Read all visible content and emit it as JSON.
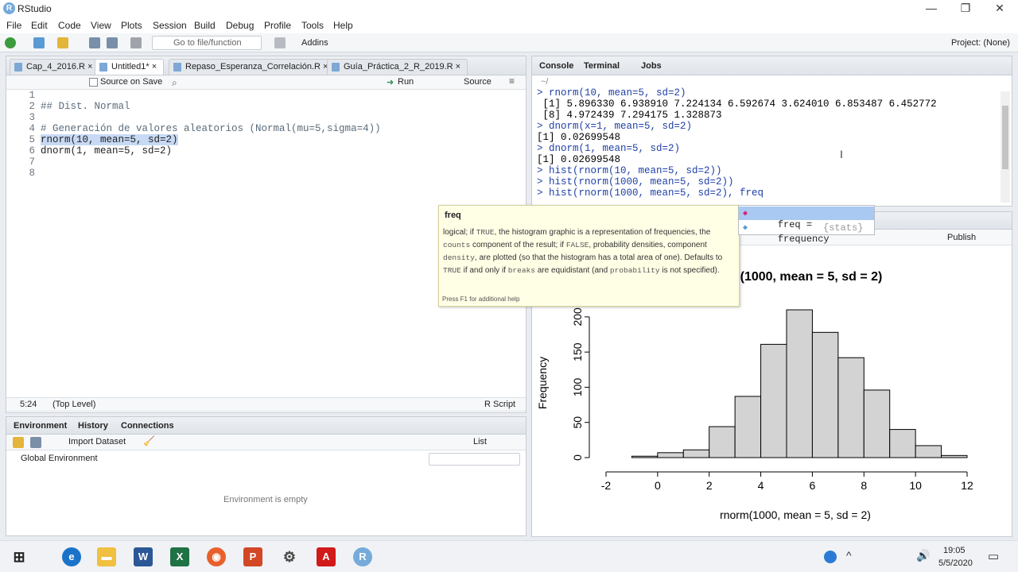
{
  "window": {
    "title": "RStudio",
    "minimize": "—",
    "restore": "❐",
    "close": "✕"
  },
  "menu": [
    "File",
    "Edit",
    "Code",
    "View",
    "Plots",
    "Session",
    "Build",
    "Debug",
    "Profile",
    "Tools",
    "Help"
  ],
  "toolbar": {
    "goto_placeholder": "Go to file/function",
    "addins_label": "Addins",
    "project_label": "Project: (None)"
  },
  "editor": {
    "tabs": [
      "Cap_4_2016.R",
      "Untitled1*",
      "Repaso_Esperanza_Correlación.R",
      "Guía_Práctica_2_R_2019.R"
    ],
    "source_on_save": "Source on Save",
    "run_label": "Run",
    "source_label": "Source",
    "lines": [
      {
        "n": "1",
        "text": ""
      },
      {
        "n": "2",
        "text": "## Dist. Normal"
      },
      {
        "n": "3",
        "text": ""
      },
      {
        "n": "4",
        "text": "# Generación de valores aleatorios (Normal(mu=5,sigma=4))"
      },
      {
        "n": "5",
        "text": "rnorm(10, mean=5, sd=2)"
      },
      {
        "n": "6",
        "text": "dnorm(1, mean=5, sd=2)"
      },
      {
        "n": "7",
        "text": ""
      },
      {
        "n": "8",
        "text": ""
      }
    ],
    "status_pos": "5:24",
    "status_scope": "(Top Level)",
    "status_type": "R Script"
  },
  "env": {
    "tabs": [
      "Environment",
      "History",
      "Connections"
    ],
    "import_label": "Import Dataset",
    "list_label": "List",
    "global_env": "Global Environment",
    "empty_text": "Environment is empty"
  },
  "console": {
    "tabs": [
      "Console",
      "Terminal",
      "Jobs"
    ],
    "path": "~/",
    "lines": [
      {
        "kind": "cmd",
        "text": "> rnorm(10, mean=5, sd=2)"
      },
      {
        "kind": "out",
        "text": " [1] 5.896330 6.938910 7.224134 6.592674 3.624010 6.853487 6.452772"
      },
      {
        "kind": "out",
        "text": " [8] 4.972439 7.294175 1.328873"
      },
      {
        "kind": "cmd",
        "text": "> dnorm(x=1, mean=5, sd=2)"
      },
      {
        "kind": "out",
        "text": "[1] 0.02699548"
      },
      {
        "kind": "cmd",
        "text": "> dnorm(1, mean=5, sd=2)"
      },
      {
        "kind": "out",
        "text": "[1] 0.02699548"
      },
      {
        "kind": "cmd",
        "text": "> hist(rnorm(10, mean=5, sd=2))"
      },
      {
        "kind": "cmd",
        "text": "> hist(rnorm(1000, mean=5, sd=2))"
      },
      {
        "kind": "cmd",
        "text": "> hist(rnorm(1000, mean=5, sd=2), freq"
      }
    ]
  },
  "autocomplete": {
    "items": [
      {
        "label": "freq =",
        "pkg": ""
      },
      {
        "label": "frequency",
        "pkg": "{stats}"
      }
    ]
  },
  "tooltip": {
    "title": "freq",
    "body_parts": [
      {
        "t": "logical; if ",
        "code": false
      },
      {
        "t": "TRUE",
        "code": true
      },
      {
        "t": ", the histogram graphic is a representation of frequencies, the ",
        "code": false
      },
      {
        "t": "counts",
        "code": true
      },
      {
        "t": " component of the result; if ",
        "code": false
      },
      {
        "t": "FALSE",
        "code": true
      },
      {
        "t": ", probability densities, component ",
        "code": false
      },
      {
        "t": "density",
        "code": true
      },
      {
        "t": ", are plotted (so that the histogram has a total area of one). Defaults to ",
        "code": false
      },
      {
        "t": "TRUE",
        "code": true
      },
      {
        "t": " if and only if ",
        "code": false
      },
      {
        "t": "breaks",
        "code": true
      },
      {
        "t": " are equidistant (and ",
        "code": false
      },
      {
        "t": "probability",
        "code": true
      },
      {
        "t": " is not specified).",
        "code": false
      }
    ],
    "footer": "Press F1 for additional help"
  },
  "plots": {
    "publish_label": "Publish"
  },
  "chart_data": {
    "type": "bar",
    "title": "norm(1000, mean = 5, sd = 2)",
    "xlabel": "rnorm(1000, mean = 5, sd = 2)",
    "ylabel": "Frequency",
    "bin_edges": [
      -1,
      0,
      1,
      2,
      3,
      4,
      5,
      6,
      7,
      8,
      9,
      10,
      11
    ],
    "values": [
      2,
      7,
      11,
      44,
      87,
      161,
      210,
      178,
      142,
      96,
      40,
      17,
      3
    ],
    "xlim": [
      -2,
      12
    ],
    "ylim": [
      0,
      210
    ],
    "xticks": [
      "-2",
      "0",
      "2",
      "4",
      "6",
      "8",
      "10",
      "12"
    ],
    "yticks": [
      "0",
      "50",
      "100",
      "150",
      "200"
    ],
    "bar_color": "#d3d3d3"
  },
  "taskbar": {
    "clock_time": "19:05",
    "clock_date": "5/5/2020"
  }
}
